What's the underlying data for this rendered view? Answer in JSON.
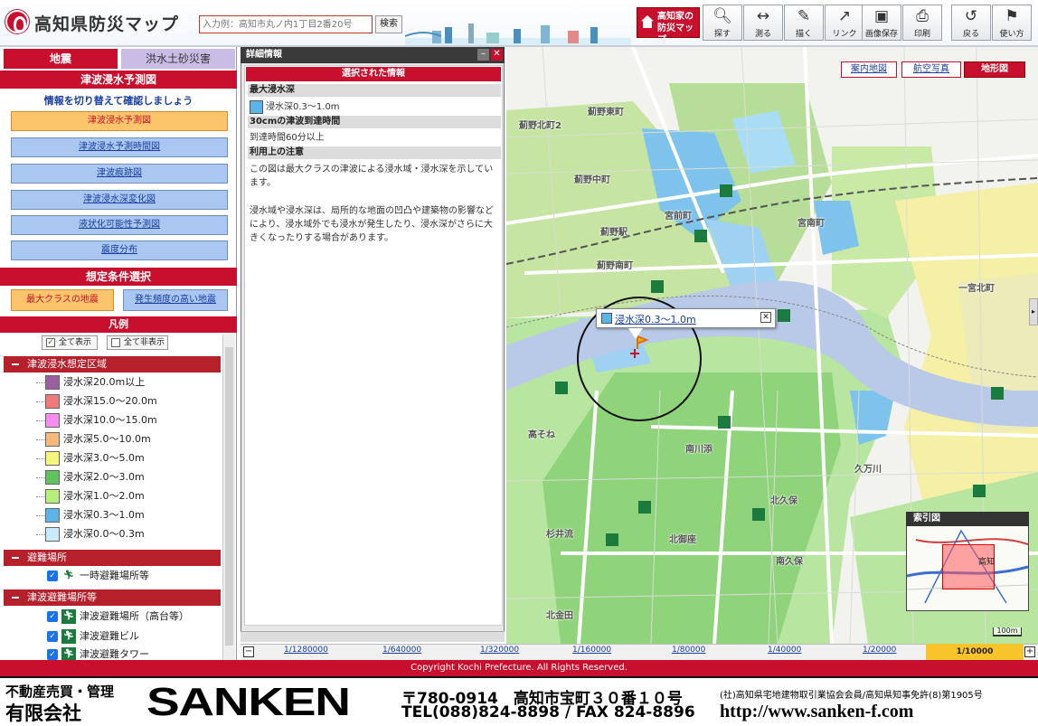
{
  "header": {
    "app_title": "高知県防災マップ",
    "search_placeholder": "入力例：高知市丸ノ内1丁目2番20号",
    "search_button": "検索",
    "bousai_button": "高知家の防災マップ",
    "tools": [
      {
        "label": "探す",
        "icon": "magnifier-icon"
      },
      {
        "label": "測る",
        "icon": "ruler-icon"
      },
      {
        "label": "描く",
        "icon": "palette-icon"
      },
      {
        "label": "リンク",
        "icon": "link-icon"
      },
      {
        "label": "画像保存",
        "icon": "save-icon"
      },
      {
        "label": "印刷",
        "icon": "printer-icon"
      },
      {
        "label": "戻る",
        "icon": "undo-icon"
      },
      {
        "label": "使い方",
        "icon": "help-icon"
      }
    ]
  },
  "tabs": {
    "jishin": "地震",
    "kozui": "洪水土砂災害"
  },
  "tsunami_section": {
    "title": "津波浸水予測図",
    "info": "情報を切り替えて確認しましょう",
    "buttons": [
      "津波浸水予測図",
      "津波浸水予測時間図",
      "津波痕跡図",
      "津波浸水深変化図",
      "液状化可能性予測図",
      "震度分布"
    ]
  },
  "condition_section": {
    "title": "想定条件選択",
    "max_quake": "最大クラスの地震",
    "freq_quake": "発生頻度の高い地震"
  },
  "legend": {
    "title": "凡例",
    "show_all": "全て表示",
    "hide_all": "全て非表示",
    "group_tsunami": "津波浸水想定区域",
    "items": [
      {
        "label": "浸水深20.0m以上",
        "color": "#9b5fa0"
      },
      {
        "label": "浸水深15.0～20.0m",
        "color": "#f07a7a"
      },
      {
        "label": "浸水深10.0～15.0m",
        "color": "#f58cf0"
      },
      {
        "label": "浸水深5.0～10.0m",
        "color": "#f7b87a"
      },
      {
        "label": "浸水深3.0～5.0m",
        "color": "#f5f57a"
      },
      {
        "label": "浸水深2.0～3.0m",
        "color": "#5fc45f"
      },
      {
        "label": "浸水深1.0～2.0m",
        "color": "#b6f07a"
      },
      {
        "label": "浸水深0.3～1.0m",
        "color": "#5ab4e8"
      },
      {
        "label": "浸水深0.0～0.3m",
        "color": "#c8eafc"
      }
    ],
    "group_hinan": "避難場所",
    "hinan_item": "一時避難場所等",
    "group_tsunami_hinan": "津波避難場所等",
    "tsunami_hinan_items": [
      "津波避難場所（高台等）",
      "津波避難ビル",
      "津波避難タワー"
    ]
  },
  "detail": {
    "title": "詳細情報",
    "selected": "選択された情報",
    "max_depth_head": "最大浸水深",
    "max_depth_value": "浸水深0.3～1.0m",
    "arrival_head": "30cmの津波到達時間",
    "arrival_value": "到達時間60分以上",
    "notes_head": "利用上の注意",
    "note1": "この図は最大クラスの津波による浸水域・浸水深を示しています。",
    "note2": "浸水域や浸水深は、局所的な地面の凹凸や建築物の影響などにより、浸水域外でも浸水が発生したり、浸水深がさらに大きくなったりする場合があります。"
  },
  "map": {
    "type_anchor": "案内地図",
    "type_air": "航空写真",
    "type_terrain": "地形図",
    "popup_label": "浸水深0.3～1.0m",
    "index_title": "索引図",
    "index_label": "高知",
    "scale_bar": "100m",
    "place_labels": [
      {
        "text": "薊野北町2",
        "cls": "pl1"
      },
      {
        "text": "薊野東町",
        "cls": "pl2"
      },
      {
        "text": "薊野中町",
        "cls": "pl3"
      },
      {
        "text": "薊野南町",
        "cls": "pl4"
      },
      {
        "text": "宮前町",
        "cls": "pl5"
      },
      {
        "text": "宮南町",
        "cls": "pl5b"
      },
      {
        "text": "一宮北町",
        "cls": "pl6"
      },
      {
        "text": "南川添",
        "cls": "pl7"
      },
      {
        "text": "北久保",
        "cls": "pl8"
      },
      {
        "text": "杉井流",
        "cls": "pl9"
      },
      {
        "text": "北御座",
        "cls": "pl10"
      },
      {
        "text": "南久保",
        "cls": "pl11"
      },
      {
        "text": "北金田",
        "cls": "pl12"
      },
      {
        "text": "高そね",
        "cls": "pl13"
      },
      {
        "text": "久万川",
        "cls": "pl14"
      },
      {
        "text": "薊野駅",
        "cls": "pl15"
      }
    ]
  },
  "scales": [
    "1/1280000",
    "1/640000",
    "1/320000",
    "1/160000",
    "1/80000",
    "1/40000",
    "1/20000"
  ],
  "scale_active": "1/10000",
  "copyright": "Copyright Kochi Prefecture. All Rights Reserved.",
  "banner": {
    "line1": "不動産売買・管理",
    "line2": "有限会社",
    "brand": "SANKEN",
    "address": "〒780-0914　高知市宝町３０番１０号",
    "tel": "TEL(088)824-8898 / FAX 824-8896",
    "assoc": "(社)高知県宅地建物取引業協会会員/高知県知事免許(8)第1905号",
    "url": "http://www.sanken-f.com"
  },
  "colors": {
    "accent": "#c8102e",
    "link": "#1a3fa0",
    "active_orange": "#fcc56b",
    "inactive_blue": "#a9c7f0"
  }
}
